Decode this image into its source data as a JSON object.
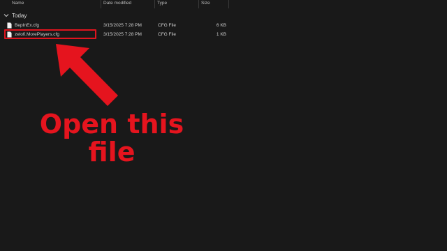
{
  "columns": {
    "name": "Name",
    "date_modified": "Date modified",
    "type": "Type",
    "size": "Size"
  },
  "group": {
    "label": "Today"
  },
  "files": [
    {
      "name": "BepInEx.cfg",
      "date": "3/15/2025 7:28 PM",
      "type": "CFG File",
      "size": "6 KB"
    },
    {
      "name": "zelofi.MorePlayers.cfg",
      "date": "3/15/2025 7:28 PM",
      "type": "CFG File",
      "size": "1 KB"
    }
  ],
  "annotation": {
    "line1": "Open this",
    "line2": "file",
    "color": "#e5141e"
  }
}
